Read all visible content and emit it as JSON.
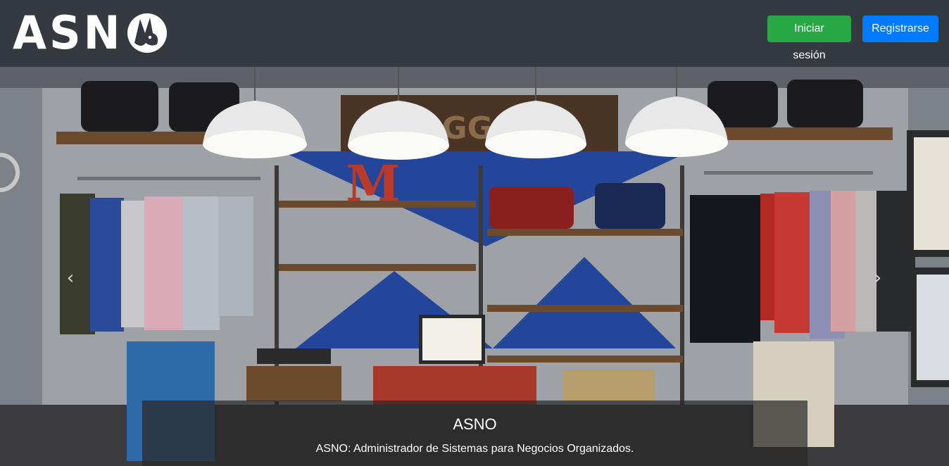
{
  "brand": {
    "logo_text": "ASN",
    "logo_mark": "donkey-head-icon"
  },
  "nav": {
    "login_label": "Iniciar sesión",
    "register_label": "Registrarse"
  },
  "carousel": {
    "prev_icon": "chevron-left-icon",
    "next_icon": "chevron-right-icon",
    "slide": {
      "title": "ASNO",
      "text": "ASNO: Administrador de Sistemas para Negocios Organizados."
    }
  },
  "scene": {
    "sign_text": "BAGGAGE",
    "shelf_letter": "M"
  },
  "colors": {
    "navbar": "#343a40",
    "login": "#28a745",
    "register": "#007bff"
  }
}
